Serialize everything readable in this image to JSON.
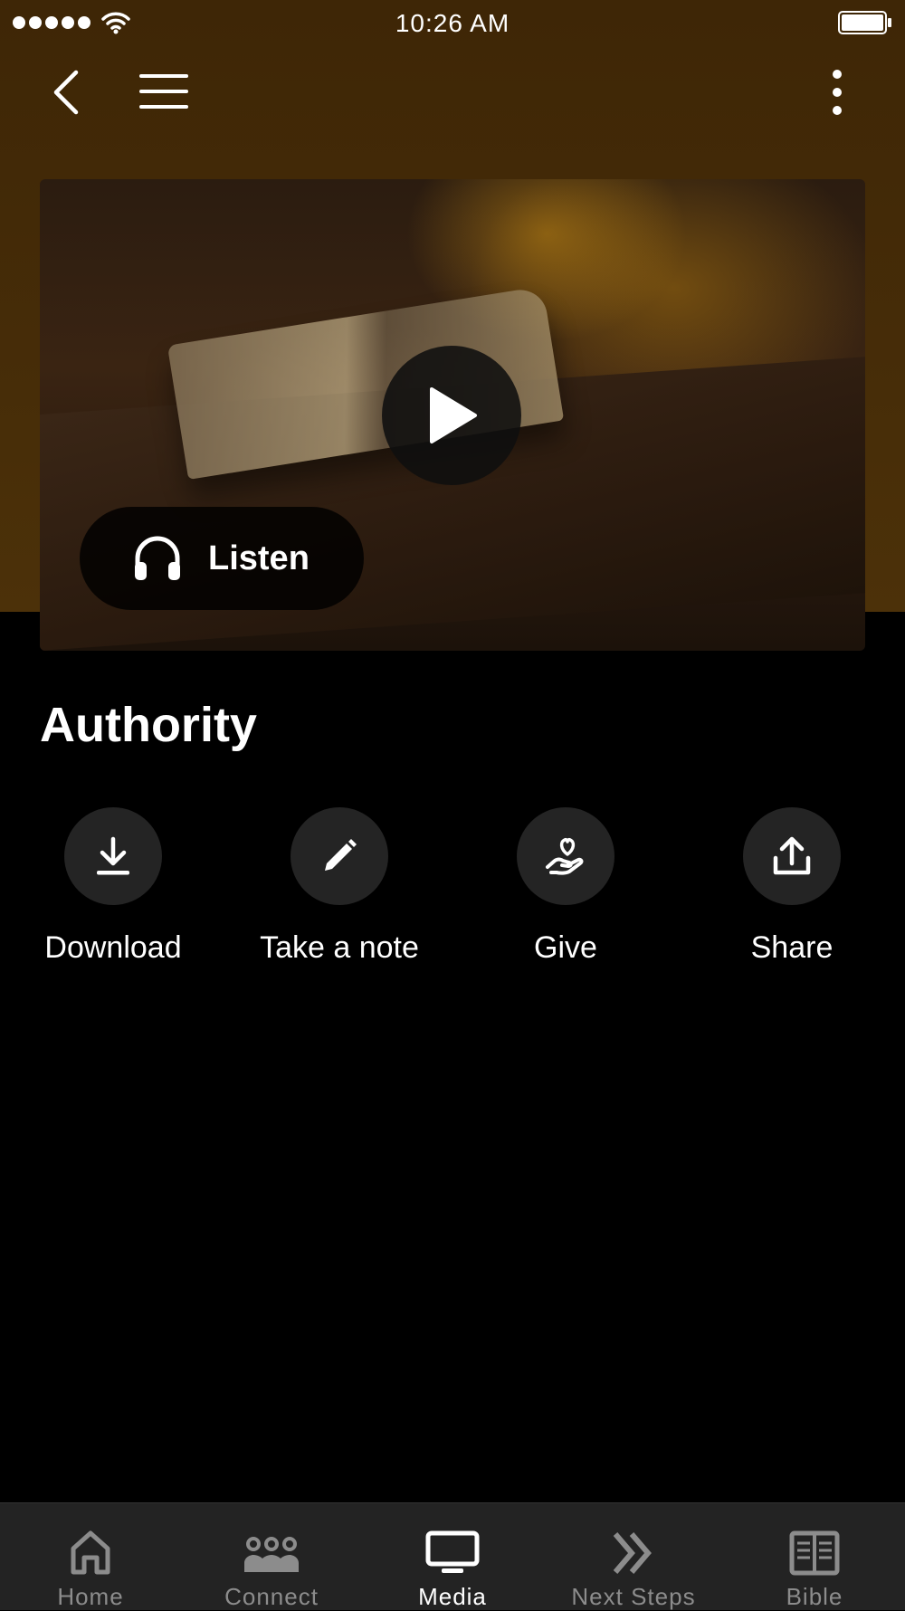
{
  "status_bar": {
    "time": "10:26 AM"
  },
  "media": {
    "title": "Authority",
    "listen_label": "Listen"
  },
  "actions": [
    {
      "label": "Download",
      "icon": "download-icon"
    },
    {
      "label": "Take a note",
      "icon": "pencil-icon"
    },
    {
      "label": "Give",
      "icon": "give-icon"
    },
    {
      "label": "Share",
      "icon": "share-icon"
    }
  ],
  "tabs": [
    {
      "label": "Home",
      "icon": "home-icon",
      "active": false
    },
    {
      "label": "Connect",
      "icon": "group-icon",
      "active": false
    },
    {
      "label": "Media",
      "icon": "tv-icon",
      "active": true
    },
    {
      "label": "Next Steps",
      "icon": "double-chevron-icon",
      "active": false
    },
    {
      "label": "Bible",
      "icon": "book-icon",
      "active": false
    }
  ],
  "colors": {
    "header_bg": "#3e2606",
    "page_bg": "#000000",
    "tabbar_bg": "#232323",
    "tab_inactive": "#8c8c8c",
    "tab_active": "#ffffff"
  }
}
